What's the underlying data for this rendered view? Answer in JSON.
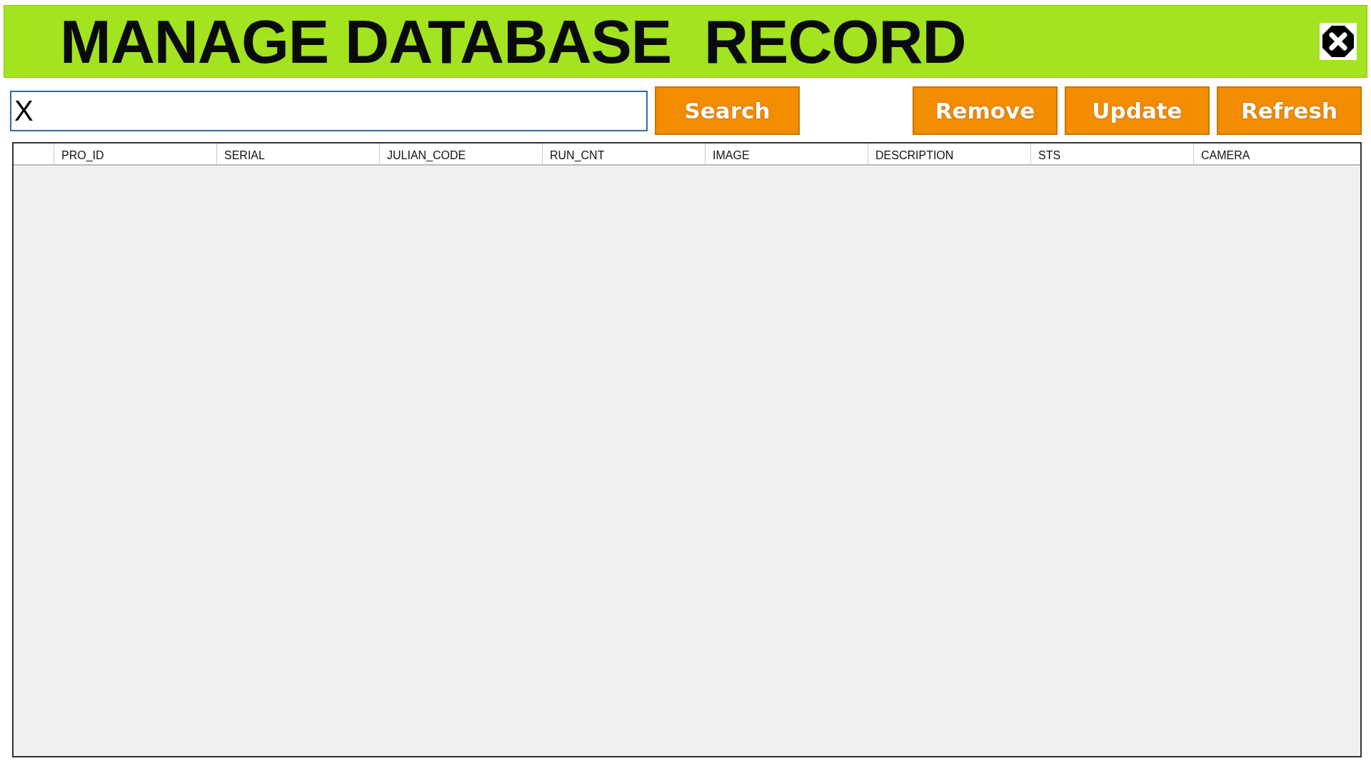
{
  "window": {
    "title": "MANAGE DATABASE  RECORD"
  },
  "search": {
    "value": "X"
  },
  "buttons": [
    {
      "label": "Search",
      "kind": "search"
    },
    {
      "label": "Remove",
      "kind": "action"
    },
    {
      "label": "Update",
      "kind": "action"
    },
    {
      "label": "Refresh",
      "kind": "action"
    }
  ],
  "table": {
    "columns": [
      "PRO_ID",
      "SERIAL",
      "JULIAN_CODE",
      "RUN_CNT",
      "IMAGE",
      "DESCRIPTION",
      "STS",
      "CAMERA"
    ]
  }
}
